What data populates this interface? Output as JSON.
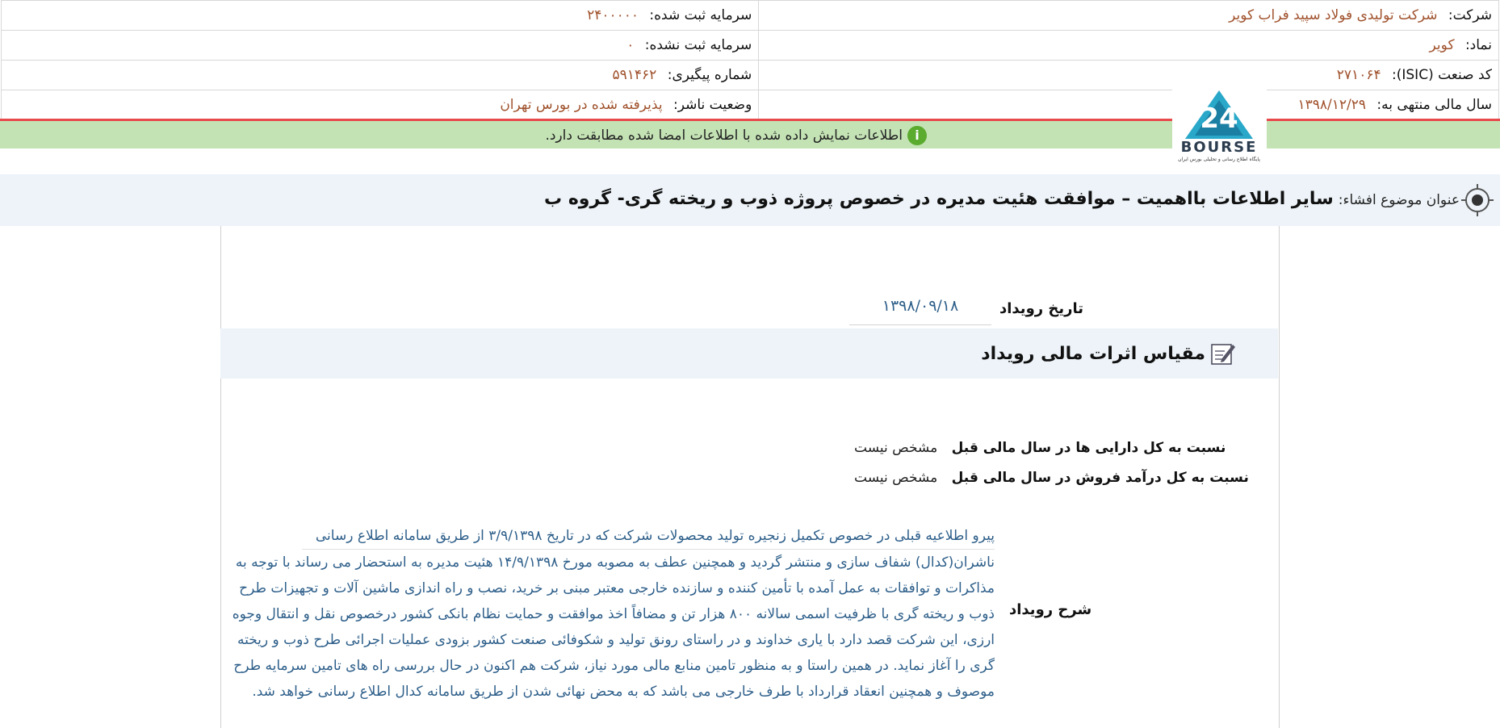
{
  "header": {
    "company_label": "شرکت:",
    "company_value": "شرکت تولیدی فولاد سپید فراب کویر",
    "registered_capital_label": "سرمایه ثبت شده:",
    "registered_capital_value": "۲۴۰۰۰۰۰",
    "symbol_label": "نماد:",
    "symbol_value": "کویر",
    "unregistered_capital_label": "سرمایه ثبت نشده:",
    "unregistered_capital_value": "۰",
    "isic_label": "کد صنعت (ISIC):",
    "isic_value": "۲۷۱۰۶۴",
    "tracking_label": "شماره پیگیری:",
    "tracking_value": "۵۹۱۴۶۲",
    "fiscal_year_label": "سال مالی منتهی به:",
    "fiscal_year_value": "۱۳۹۸/۱۲/۲۹",
    "publisher_status_label": "وضعیت ناشر:",
    "publisher_status_value": "پذیرفته شده در بورس تهران"
  },
  "notice": {
    "message": "اطلاعات نمایش داده شده با اطلاعات امضا شده مطابقت دارد.",
    "icon": "info-icon",
    "icon_glyph": "i"
  },
  "logo": {
    "brand_text": "BOURSE",
    "subtitle": "پایگاه اطلاع رسانی و تحلیلی بورس ایران",
    "mark": "24"
  },
  "title": {
    "prefix": "عنوان موضوع افشاء:",
    "text": "سایر اطلاعات بااهمیت – موافقت هئیت مدیره در خصوص پروژه ذوب و ریخته گری- گروه ب"
  },
  "event_date": {
    "label": "تاریخ رویداد",
    "value": "۱۳۹۸/۰۹/۱۸"
  },
  "financial_effects": {
    "heading": "مقیاس اثرات مالی رویداد",
    "assets_label": "نسبت به کل دارایی ها در سال مالی قبل",
    "assets_value": "مشخص نیست",
    "revenue_label": "نسبت به کل درآمد فروش در سال مالی قبل",
    "revenue_value": "مشخص نیست"
  },
  "description": {
    "label": "شرح رویداد",
    "lines": [
      "پیرو اطلاعیه قبلی در خصوص تکمیل زنجیره تولید محصولات شرکت که در تاریخ ۳/۹/۱۳۹۸ از طریق سامانه اطلاع رسانی",
      "ناشران(کدال) شفاف سازی و منتشر گردید و همچنین عطف به مصوبه مورخ ۱۴/۹/۱۳۹۸ هئیت مدیره به استحضار می رساند با توجه به",
      "مذاکرات و توافقات به عمل آمده با تأمین کننده و سازنده خارجی معتبر مبنی بر خرید، نصب و راه اندازی ماشین آلات و تجهیزات طرح",
      "ذوب و ریخته گری با ظرفیت اسمی سالانه ۸۰۰ هزار تن و مضافاً اخذ موافقت و حمایت نظام بانکی کشور درخصوص نقل و انتقال وجوه",
      "ارزی، این شرکت قصد دارد با یاری خداوند و در راستای رونق تولید و شکوفائی صنعت کشور بزودی عملیات اجرائی طرح ذوب و ریخته",
      "گری را آغاز نماید. در همین راستا و به منظور تامین منابع مالی مورد نیاز، شرکت هم اکنون در حال بررسی راه های تامین سرمایه طرح",
      "موصوف و همچنین انعقاد قرارداد با طرف خارجی می باشد که به محض نهائی شدن از طریق سامانه کدال اطلاع رسانی خواهد شد."
    ]
  },
  "colors": {
    "value_text": "#a0522d",
    "description_text": "#2e5f8a",
    "notice_bg": "#c4e3b5",
    "red_rule": "#e8494b",
    "title_bg": "#edf3f8"
  }
}
